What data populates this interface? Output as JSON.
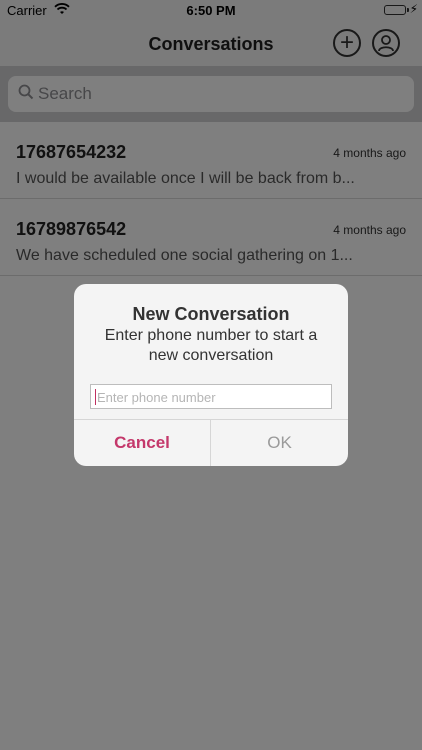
{
  "status_bar": {
    "carrier": "Carrier",
    "time": "6:50 PM"
  },
  "nav": {
    "title": "Conversations",
    "add_icon": "plus-circle-icon",
    "profile_icon": "user-circle-icon"
  },
  "search": {
    "placeholder": "Search"
  },
  "conversations": [
    {
      "number": "17687654232",
      "time": "4 months ago",
      "preview": "I would be available once I will be back from b..."
    },
    {
      "number": "16789876542",
      "time": "4 months ago",
      "preview": "We have scheduled one social  gathering on 1..."
    }
  ],
  "dialog": {
    "title": "New Conversation",
    "message": "Enter phone number to start a new conversation",
    "input_placeholder": "Enter phone number",
    "cancel": "Cancel",
    "ok": "OK"
  },
  "colors": {
    "accent": "#c4386b",
    "battery": "#4cd964"
  }
}
